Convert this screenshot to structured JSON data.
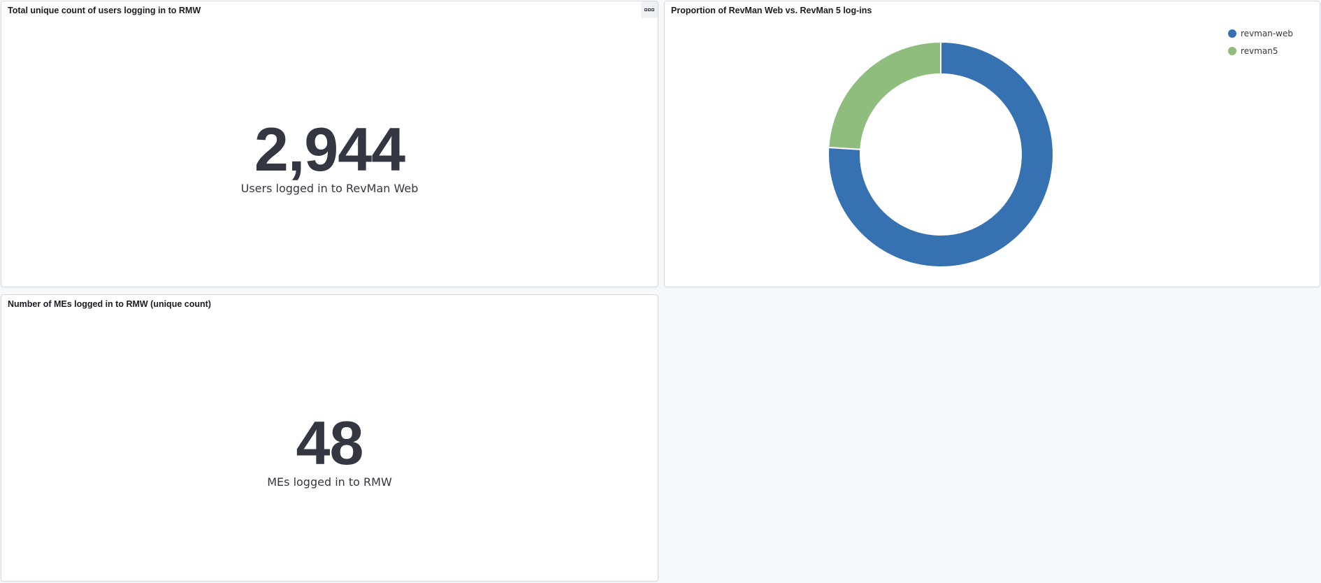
{
  "panels": {
    "users": {
      "title": "Total unique count of users logging in to RMW",
      "value": "2,944",
      "label": "Users logged in to RevMan Web",
      "options_icon": "ellipsis-icon"
    },
    "proportion": {
      "title": "Proportion of RevMan Web vs. RevMan 5 log-ins"
    },
    "mes": {
      "title": "Number of MEs logged in to RMW (unique count)",
      "value": "48",
      "label": "MEs logged in to RMW"
    }
  },
  "chart_data": {
    "type": "pie",
    "donut": true,
    "title": "Proportion of RevMan Web vs. RevMan 5 log-ins",
    "legend_position": "top-right",
    "slices": [
      {
        "name": "revman-web",
        "value": 76,
        "color": "#3672b2"
      },
      {
        "name": "revman5",
        "value": 24,
        "color": "#8fbd7e"
      }
    ]
  },
  "colors": {
    "metric_text": "#343741",
    "panel_border": "#d3dae6",
    "background": "#f7f8fa"
  }
}
